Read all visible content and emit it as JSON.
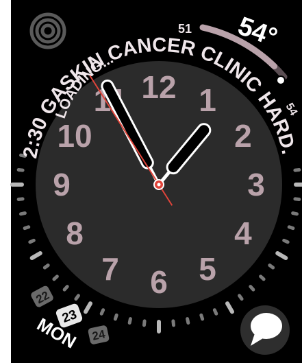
{
  "complications": {
    "top_left": {
      "icon": "activity-rings-icon"
    },
    "curved_header": {
      "loading_text": "LOADING...",
      "event_text": "SKIN CANCER CLINIC HARD...",
      "time_text": "2:30 GA"
    },
    "temperature": {
      "current": "54°",
      "low": "51",
      "high": "54",
      "fraction": 0.85
    },
    "calendar": {
      "prev_day": "22",
      "current_day": "23",
      "next_day": "24",
      "weekday": "MON"
    },
    "messages": {
      "icon": "speech-bubble-icon"
    }
  },
  "dial": {
    "numerals": [
      "12",
      "1",
      "2",
      "3",
      "4",
      "5",
      "6",
      "7",
      "8",
      "9",
      "10",
      "11"
    ],
    "hands": {
      "hour": 0.4,
      "minute": 55.4,
      "second": 54.6
    }
  },
  "colors": {
    "numeral": "#b9a2aa",
    "second_hand": "#e0443a",
    "dial_face": "#2b2b2b",
    "background": "#000000",
    "temp_gauge": "#b9a2aa"
  }
}
